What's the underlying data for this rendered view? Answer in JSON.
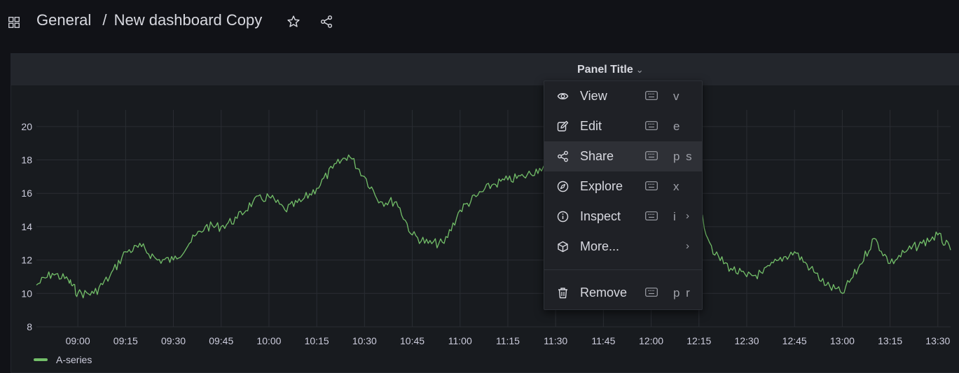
{
  "breadcrumb": {
    "folder": "General",
    "separator": "/",
    "dashboard": "New dashboard Copy"
  },
  "panel": {
    "title": "Panel Title"
  },
  "chart_data": {
    "type": "line",
    "title": "Panel Title",
    "xlabel": "",
    "ylabel": "",
    "x_ticks": [
      "09:00",
      "09:15",
      "09:30",
      "09:45",
      "10:00",
      "10:15",
      "10:30",
      "10:45",
      "11:00",
      "11:15",
      "11:30",
      "11:45",
      "12:00",
      "12:15",
      "12:30",
      "12:45",
      "13:00",
      "13:15",
      "13:30"
    ],
    "y_ticks": [
      "8",
      "10",
      "12",
      "14",
      "16",
      "18",
      "20"
    ],
    "ylim": [
      8,
      21
    ],
    "x_range": [
      "08:47",
      "13:34"
    ],
    "grid": true,
    "legend": "bottom-left",
    "color": "#73bf69",
    "series": [
      {
        "name": "A-series",
        "x": [
          "08:47",
          "08:52",
          "08:57",
          "09:00",
          "09:05",
          "09:10",
          "09:15",
          "09:20",
          "09:25",
          "09:30",
          "09:35",
          "09:40",
          "09:45",
          "09:50",
          "09:55",
          "10:00",
          "10:05",
          "10:10",
          "10:15",
          "10:20",
          "10:25",
          "10:30",
          "10:35",
          "10:40",
          "10:45",
          "10:50",
          "10:55",
          "11:00",
          "11:05",
          "11:10",
          "11:15",
          "11:20",
          "11:25",
          "11:30",
          "11:35",
          "11:40",
          "11:45",
          "11:50",
          "11:55",
          "12:00",
          "12:05",
          "12:10",
          "12:15",
          "12:20",
          "12:25",
          "12:30",
          "12:35",
          "12:40",
          "12:45",
          "12:50",
          "12:55",
          "13:00",
          "13:05",
          "13:10",
          "13:15",
          "13:20",
          "13:25",
          "13:30",
          "13:34"
        ],
        "values": [
          10.5,
          11.2,
          10.8,
          10.0,
          10.0,
          11.0,
          12.5,
          12.8,
          12.0,
          12.0,
          13.0,
          14.0,
          14.0,
          14.5,
          15.5,
          15.8,
          15.0,
          15.5,
          16.3,
          17.5,
          18.3,
          17.0,
          15.5,
          15.5,
          13.5,
          13.0,
          13.0,
          15.0,
          15.8,
          16.5,
          16.8,
          17.0,
          17.5,
          17.6,
          17.2,
          16.5,
          16.0,
          15.5,
          15.0,
          14.5,
          14.0,
          13.5,
          15.0,
          12.3,
          11.5,
          11.0,
          11.2,
          12.0,
          12.5,
          11.5,
          10.5,
          10.0,
          11.5,
          13.3,
          11.8,
          12.5,
          13.0,
          13.5,
          12.6
        ]
      }
    ]
  },
  "context_menu": {
    "items": [
      {
        "label": "View",
        "icon": "eye-icon",
        "keys": "v",
        "submenu": false
      },
      {
        "label": "Edit",
        "icon": "pencil-icon",
        "keys": "e",
        "submenu": false
      },
      {
        "label": "Share",
        "icon": "share-icon",
        "keys": "p s",
        "submenu": false,
        "active": true
      },
      {
        "label": "Explore",
        "icon": "compass-icon",
        "keys": "x",
        "submenu": false
      },
      {
        "label": "Inspect",
        "icon": "info-icon",
        "keys": "i",
        "submenu": true
      },
      {
        "label": "More...",
        "icon": "cube-icon",
        "keys": "",
        "submenu": true
      },
      {
        "label": "Remove",
        "icon": "trash-icon",
        "keys": "p r",
        "submenu": false
      }
    ],
    "submenu_glyph": "›"
  }
}
